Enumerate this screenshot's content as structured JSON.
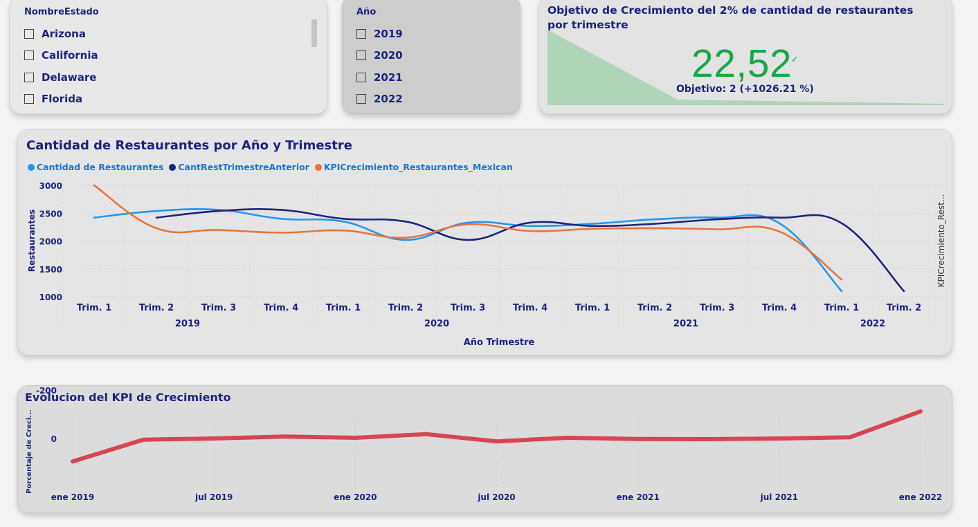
{
  "estado_slicer": {
    "title": "NombreEstado",
    "items": [
      "Arizona",
      "California",
      "Delaware",
      "Florida"
    ]
  },
  "anio_slicer": {
    "title": "Año",
    "items": [
      "2019",
      "2020",
      "2021",
      "2022"
    ]
  },
  "kpi_card": {
    "title": "Objetivo de Crecimiento del 2% de cantidad de restaurantes por trimestre",
    "value": "22,52",
    "check": "✓",
    "target": "Objetivo: 2 (+1026.21 %)",
    "color_good": "#1aa845",
    "trend_fill": "#b0d4b8"
  },
  "line_chart": {
    "title": "Cantidad de Restaurantes por Año y Trimestre",
    "xlabel": "Año Trimestre",
    "ylabel": "Restaurantes",
    "y2label": "KPICrecimiento_Rest...",
    "years": [
      "2019",
      "2020",
      "2021",
      "2022"
    ],
    "quarter_labels": [
      "Trim. 1",
      "Trim. 2",
      "Trim. 3",
      "Trim. 4",
      "Trim. 1",
      "Trim. 2",
      "Trim. 3",
      "Trim. 4",
      "Trim. 1",
      "Trim. 2",
      "Trim. 3",
      "Trim. 4",
      "Trim. 1",
      "Trim. 2"
    ],
    "y_ticks": [
      "3000",
      "2500",
      "2000",
      "1500",
      "1000"
    ]
  },
  "kpi_chart": {
    "title": "Evolucion del KPI de Crecimiento",
    "ylabel": "Porcentaje de Creci...",
    "y_ticks": [
      "0",
      "-200"
    ],
    "x_ticks": [
      "ene 2019",
      "jul 2019",
      "ene 2020",
      "jul 2020",
      "ene 2021",
      "jul 2021",
      "ene 2022"
    ],
    "line_color": "#d64550"
  },
  "chart_data": [
    {
      "type": "line",
      "title": "Cantidad de Restaurantes por Año y Trimestre",
      "xlabel": "Año Trimestre",
      "ylabel": "Restaurantes",
      "ylim": [
        1000,
        3000
      ],
      "categories": [
        "2019 Trim. 1",
        "2019 Trim. 2",
        "2019 Trim. 3",
        "2019 Trim. 4",
        "2020 Trim. 1",
        "2020 Trim. 2",
        "2020 Trim. 3",
        "2020 Trim. 4",
        "2021 Trim. 1",
        "2021 Trim. 2",
        "2021 Trim. 3",
        "2021 Trim. 4",
        "2022 Trim. 1",
        "2022 Trim. 2"
      ],
      "legend_position": "top-left",
      "series": [
        {
          "name": "Cantidad de Restaurantes",
          "color": "#2196f3",
          "values": [
            2420,
            2540,
            2560,
            2400,
            2350,
            2020,
            2330,
            2270,
            2310,
            2390,
            2420,
            2320,
            1100,
            null
          ]
        },
        {
          "name": "CantRestTrimestreAnterior",
          "color": "#1a237e",
          "values": [
            null,
            2420,
            2540,
            2560,
            2400,
            2350,
            2020,
            2330,
            2270,
            2310,
            2390,
            2420,
            2320,
            1100
          ]
        },
        {
          "name": "KPICrecimiento_Restaurantes_Mexican",
          "color": "#e8743b",
          "values": [
            3000,
            2230,
            2200,
            2150,
            2190,
            2060,
            2300,
            2180,
            2220,
            2230,
            2210,
            2170,
            1310,
            null
          ]
        }
      ]
    },
    {
      "type": "line",
      "title": "Evolucion del KPI de Crecimiento",
      "xlabel": "",
      "ylabel": "Porcentaje de Creci...",
      "ylim": [
        -200,
        100
      ],
      "x": [
        "ene 2019",
        "abr 2019",
        "jul 2019",
        "oct 2019",
        "ene 2020",
        "abr 2020",
        "jul 2020",
        "oct 2020",
        "ene 2021",
        "abr 2021",
        "jul 2021",
        "oct 2021",
        "ene 2022"
      ],
      "series": [
        {
          "color": "#d64550",
          "values": [
            95,
            5,
            0,
            -8,
            -3,
            -18,
            12,
            -3,
            2,
            3,
            0,
            -5,
            -112
          ]
        }
      ]
    }
  ]
}
